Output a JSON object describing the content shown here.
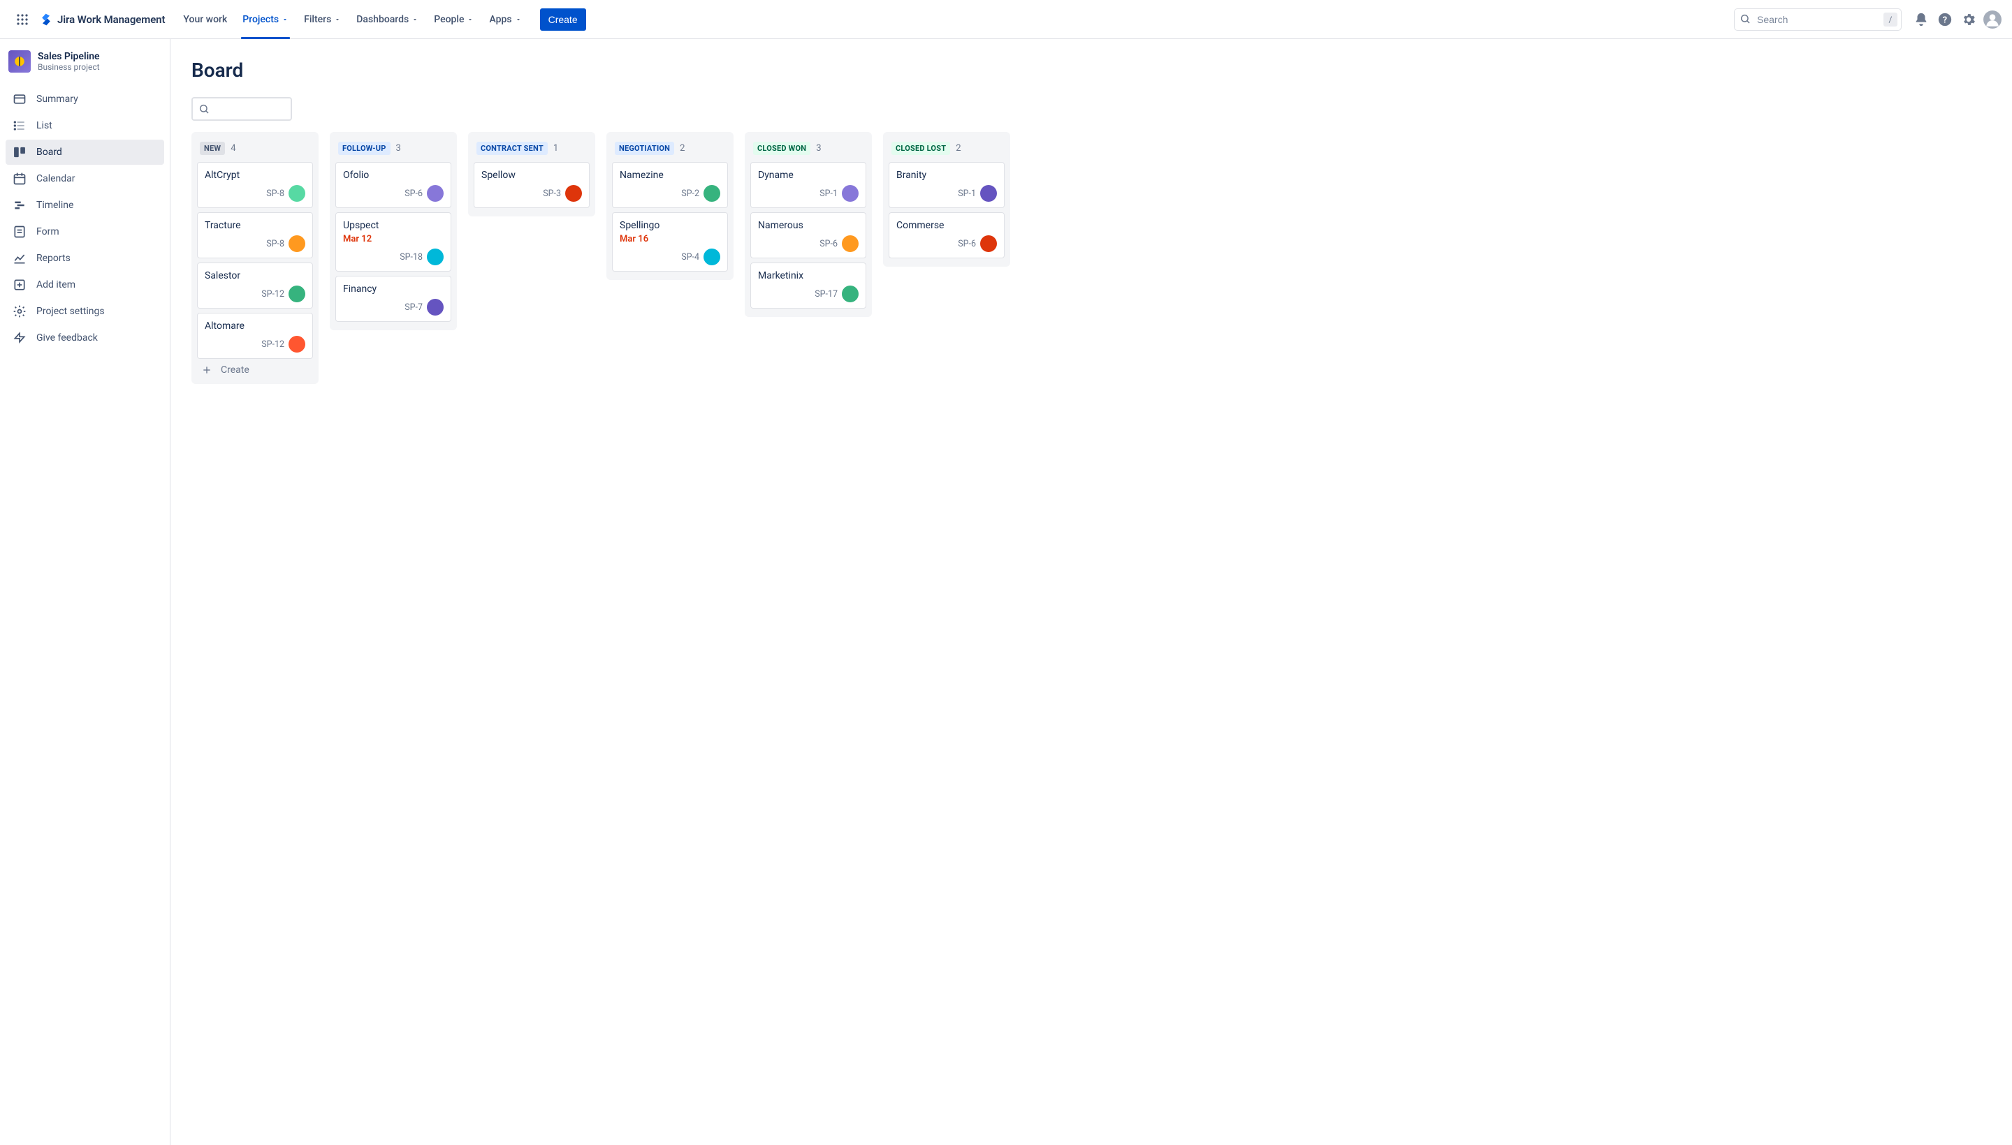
{
  "topnav": {
    "product_name": "Jira Work Management",
    "items": [
      {
        "label": "Your work",
        "has_caret": false,
        "active": false
      },
      {
        "label": "Projects",
        "has_caret": true,
        "active": true
      },
      {
        "label": "Filters",
        "has_caret": true,
        "active": false
      },
      {
        "label": "Dashboards",
        "has_caret": true,
        "active": false
      },
      {
        "label": "People",
        "has_caret": true,
        "active": false
      },
      {
        "label": "Apps",
        "has_caret": true,
        "active": false
      }
    ],
    "create_label": "Create",
    "search_placeholder": "Search",
    "search_slash": "/"
  },
  "sidebar": {
    "project_name": "Sales Pipeline",
    "project_type": "Business project",
    "items": [
      {
        "label": "Summary",
        "icon": "card"
      },
      {
        "label": "List",
        "icon": "list"
      },
      {
        "label": "Board",
        "icon": "board"
      },
      {
        "label": "Calendar",
        "icon": "calendar"
      },
      {
        "label": "Timeline",
        "icon": "timeline"
      },
      {
        "label": "Form",
        "icon": "form"
      },
      {
        "label": "Reports",
        "icon": "reports"
      },
      {
        "label": "Add item",
        "icon": "add"
      },
      {
        "label": "Project settings",
        "icon": "gear"
      },
      {
        "label": "Give feedback",
        "icon": "feedback"
      }
    ],
    "active_index": 2
  },
  "board": {
    "title": "Board",
    "create_label": "Create",
    "columns": [
      {
        "name": "NEW",
        "count": 4,
        "status_class": "status-grey",
        "show_create": true,
        "cards": [
          {
            "title": "AltCrypt",
            "key": "SP-8",
            "avatar_color": "#57D9A3"
          },
          {
            "title": "Tracture",
            "key": "SP-8",
            "avatar_color": "#FF991F"
          },
          {
            "title": "Salestor",
            "key": "SP-12",
            "avatar_color": "#36B37E"
          },
          {
            "title": "Altomare",
            "key": "SP-12",
            "avatar_color": "#FF5630"
          }
        ]
      },
      {
        "name": "FOLLOW-UP",
        "count": 3,
        "status_class": "status-blue",
        "cards": [
          {
            "title": "Ofolio",
            "key": "SP-6",
            "avatar_color": "#8777D9"
          },
          {
            "title": "Upspect",
            "key": "SP-18",
            "avatar_color": "#00B8D9",
            "date": "Mar 12",
            "date_class": "date-red"
          },
          {
            "title": "Financy",
            "key": "SP-7",
            "avatar_color": "#6554C0"
          }
        ]
      },
      {
        "name": "CONTRACT SENT",
        "count": 1,
        "status_class": "status-blue",
        "cards": [
          {
            "title": "Spellow",
            "key": "SP-3",
            "avatar_color": "#DE350B"
          }
        ]
      },
      {
        "name": "NEGOTIATION",
        "count": 2,
        "status_class": "status-blue",
        "cards": [
          {
            "title": "Namezine",
            "key": "SP-2",
            "avatar_color": "#36B37E"
          },
          {
            "title": "Spellingo",
            "key": "SP-4",
            "avatar_color": "#00B8D9",
            "date": "Mar 16",
            "date_class": "date-red"
          }
        ]
      },
      {
        "name": "CLOSED WON",
        "count": 3,
        "status_class": "status-green",
        "cards": [
          {
            "title": "Dyname",
            "key": "SP-1",
            "avatar_color": "#8777D9"
          },
          {
            "title": "Namerous",
            "key": "SP-6",
            "avatar_color": "#FF991F"
          },
          {
            "title": "Marketinix",
            "key": "SP-17",
            "avatar_color": "#36B37E"
          }
        ]
      },
      {
        "name": "CLOSED LOST",
        "count": 2,
        "status_class": "status-green",
        "cards": [
          {
            "title": "Branity",
            "key": "SP-1",
            "avatar_color": "#6554C0"
          },
          {
            "title": "Commerse",
            "key": "SP-6",
            "avatar_color": "#DE350B"
          }
        ]
      }
    ]
  }
}
